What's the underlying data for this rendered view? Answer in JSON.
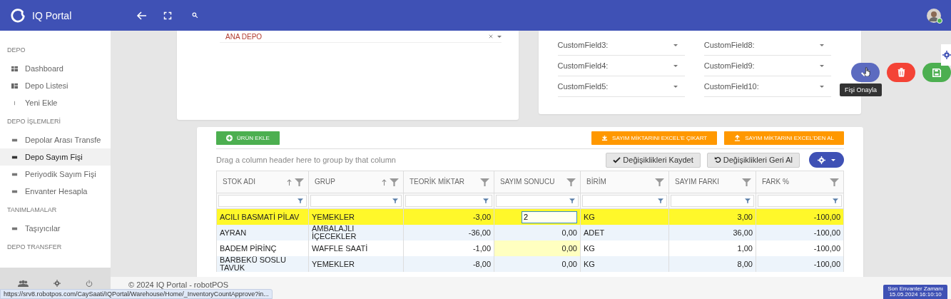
{
  "header": {
    "title": "IQ Portal",
    "avatar": {
      "online": true
    }
  },
  "sidebar": {
    "sections": [
      {
        "title": "DEPO",
        "items": [
          {
            "label": "Dashboard",
            "kind": "dashboard",
            "selected": false
          },
          {
            "label": "Depo Listesi",
            "kind": "list",
            "selected": false
          },
          {
            "label": "Yeni Ekle",
            "kind": "add",
            "selected": false
          }
        ]
      },
      {
        "title": "DEPO İŞLEMLERİ",
        "items": [
          {
            "label": "Depolar Arası Transfe",
            "kind": "bullet",
            "selected": false
          },
          {
            "label": "Depo Sayım Fişi",
            "kind": "bullet",
            "selected": true
          },
          {
            "label": "Periyodik Sayım Fişi",
            "kind": "bullet",
            "selected": false
          },
          {
            "label": "Envanter Hesapla",
            "kind": "bullet",
            "selected": false
          }
        ]
      },
      {
        "title": "TANIMLAMALAR",
        "items": [
          {
            "label": "Taşıyıcılar",
            "kind": "bullet",
            "selected": false
          }
        ]
      },
      {
        "title": "DEPO TRANSFER"
      }
    ]
  },
  "warehouse": {
    "value": "ANA DEPO"
  },
  "custom_fields": [
    [
      "CustomField3:",
      "CustomField4:",
      "CustomField5:"
    ],
    [
      "CustomField8:",
      "CustomField9:",
      "CustomField10:"
    ]
  ],
  "actions": {
    "tooltip": "Fişi Onayla"
  },
  "toolbar": {
    "add": "ÜRÜN EKLE",
    "export": "SAYIM MİKTARINI EXCEL'E ÇIKART",
    "import": "SAYIM MİKTARINI EXCEL'DEN AL",
    "group_hint": "Drag a column header here to group by that column",
    "save": "Değişiklikleri Kaydet",
    "undo": "Değişiklikleri Geri Al"
  },
  "table": {
    "columns": [
      {
        "label": "STOK ADI",
        "sortable": true,
        "kind": "text"
      },
      {
        "label": "GRUP",
        "sortable": true,
        "kind": "text"
      },
      {
        "label": "TEORİK MİKTAR",
        "sortable": false,
        "kind": "number"
      },
      {
        "label": "SAYIM SONUCU",
        "sortable": false,
        "kind": "number"
      },
      {
        "label": "BİRİM",
        "sortable": false,
        "kind": "text"
      },
      {
        "label": "SAYIM FARKI",
        "sortable": false,
        "kind": "number"
      },
      {
        "label": "FARK %",
        "sortable": false,
        "kind": "number"
      }
    ],
    "rows": [
      {
        "selected": true,
        "editing": true,
        "cells": [
          "ACILI BASMATİ PİLAV",
          "YEMEKLER",
          "-3,00",
          "2",
          "KG",
          "3,00",
          "-100,00"
        ]
      },
      {
        "selected": false,
        "editing": false,
        "cells": [
          "AYRAN",
          "AMBALAJLI İÇECEKLER",
          "-36,00",
          "0,00",
          "ADET",
          "36,00",
          "-100,00"
        ]
      },
      {
        "selected": false,
        "editing": false,
        "cells": [
          "BADEM PİRİNÇ",
          "WAFFLE SAATİ",
          "-1,00",
          "0,00",
          "KG",
          "1,00",
          "-100,00"
        ]
      },
      {
        "selected": false,
        "editing": false,
        "cells": [
          "BARBEKÜ SOSLU TAVUK",
          "YEMEKLER",
          "-8,00",
          "0,00",
          "KG",
          "8,00",
          "-100,00"
        ]
      }
    ]
  },
  "footer": {
    "copyright": "© 2024 IQ Portal - robotPOS",
    "last_inventory": [
      "Son Envanter Zamanı",
      "15.05.2024 16:10:10"
    ]
  },
  "status_url": "https://srv8.robotpos.com/CaySaati/IQPortal/Warehouse/Home/_InventoryCountApprove?in..."
}
